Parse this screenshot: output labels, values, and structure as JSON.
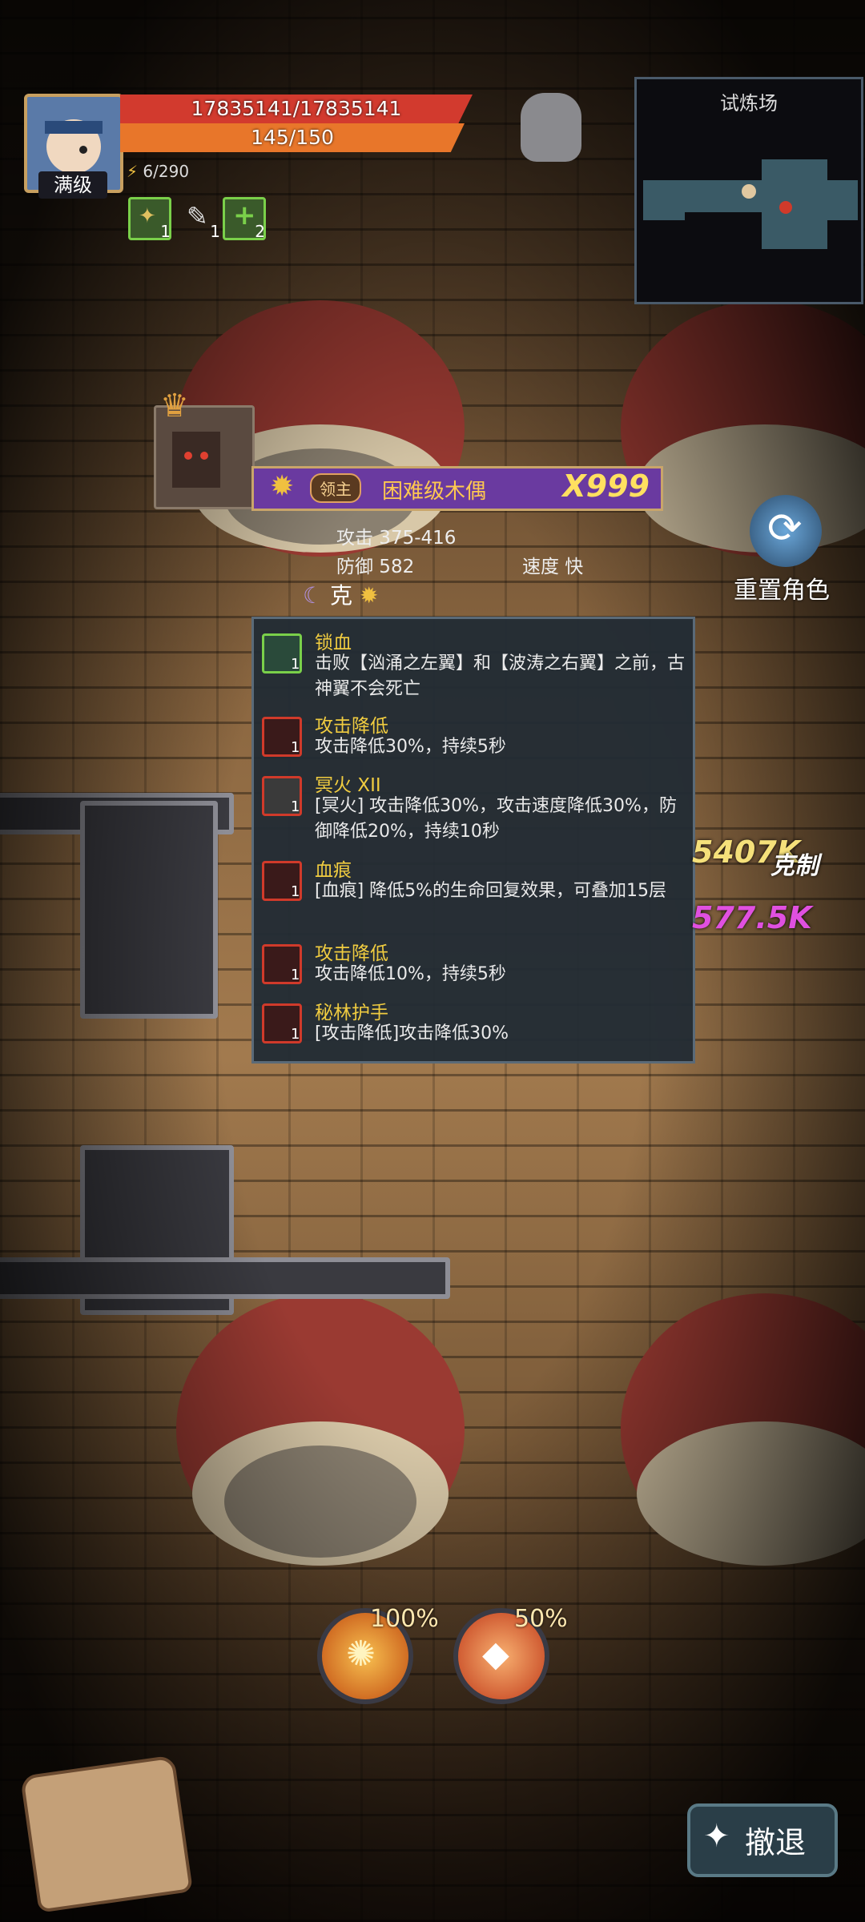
{
  "player": {
    "level_label": "满级",
    "hp_text": "17835141/17835141",
    "mp_text": "145/150",
    "energy_text": "6/290",
    "buffs": [
      {
        "icon": "bug-icon",
        "count": "1"
      },
      {
        "icon": "feather-icon",
        "count": "1"
      },
      {
        "icon": "heal-plus-icon",
        "count": "2"
      }
    ]
  },
  "minimap": {
    "title": "试炼场"
  },
  "boss": {
    "tag": "领主",
    "name": "困难级木偶",
    "multiplier": "X999",
    "attack": "攻击 375-416",
    "defense": "防御 582",
    "speed": "速度 快",
    "counter": "克"
  },
  "reset": {
    "label": "重置角色"
  },
  "effects": [
    {
      "title": "锁血",
      "count": "1",
      "desc": "击败【汹涌之左翼】和【波涛之右翼】之前，古神翼不会死亡",
      "icon": "shield-icon"
    },
    {
      "title": "攻击降低",
      "count": "1",
      "desc": "攻击降低30%，持续5秒",
      "icon": "attack-down-icon"
    },
    {
      "title": "冥火 XII",
      "count": "1",
      "desc": "[冥火] 攻击降低30%，攻击速度降低30%，防御降低20%，持续10秒",
      "icon": "dark-fire-icon"
    },
    {
      "title": "血痕",
      "count": "1",
      "desc": "[血痕] 降低5%的生命回复效果，可叠加15层",
      "icon": "blood-mark-icon"
    },
    {
      "title": "攻击降低",
      "count": "1",
      "desc": "攻击降低10%，持续5秒",
      "icon": "attack-down-icon"
    },
    {
      "title": "秘林护手",
      "count": "1",
      "desc": "[攻击降低]攻击降低30%",
      "icon": "attack-down-icon"
    }
  ],
  "damage_numbers": [
    "5407K",
    "577.5K",
    "克制"
  ],
  "skills": [
    {
      "icon": "fire-burst-icon",
      "pct": "100%"
    },
    {
      "icon": "flame-blade-icon",
      "pct": "50%"
    }
  ],
  "retreat": {
    "label": "撤退"
  },
  "colors": {
    "hp": "#d23a2e",
    "mp": "#e8762a",
    "banner": "#6a3aa0",
    "title_gold": "#f0cc40"
  }
}
